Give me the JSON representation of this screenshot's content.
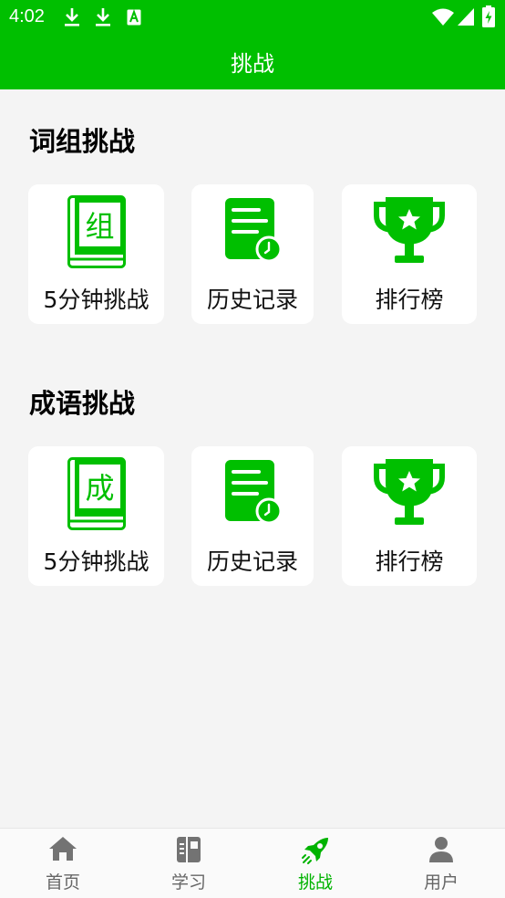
{
  "status_bar": {
    "time": "4:02"
  },
  "header": {
    "title": "挑战"
  },
  "sections": [
    {
      "title": "词组挑战",
      "book_char": "组",
      "cards": [
        {
          "label": "5分钟挑战",
          "icon": "book-icon"
        },
        {
          "label": "历史记录",
          "icon": "history-icon"
        },
        {
          "label": "排行榜",
          "icon": "trophy-icon"
        }
      ]
    },
    {
      "title": "成语挑战",
      "book_char": "成",
      "cards": [
        {
          "label": "5分钟挑战",
          "icon": "book-icon"
        },
        {
          "label": "历史记录",
          "icon": "history-icon"
        },
        {
          "label": "排行榜",
          "icon": "trophy-icon"
        }
      ]
    }
  ],
  "bottom_nav": {
    "active_index": 2,
    "items": [
      {
        "label": "首页",
        "icon": "home-icon"
      },
      {
        "label": "学习",
        "icon": "notebook-icon"
      },
      {
        "label": "挑战",
        "icon": "rocket-icon"
      },
      {
        "label": "用户",
        "icon": "user-icon"
      }
    ]
  },
  "colors": {
    "brand_green": "#00bf00",
    "background": "#f4f4f4",
    "card": "#ffffff",
    "nav_inactive": "#666666"
  }
}
